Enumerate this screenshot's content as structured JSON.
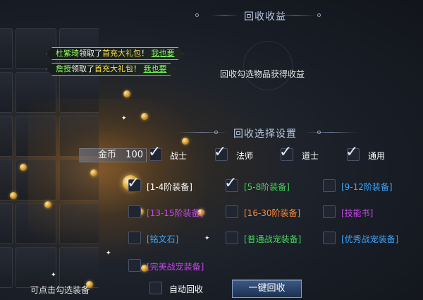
{
  "header": {
    "title": "回收收益",
    "subtitle": "回收勾选物品获得收益"
  },
  "notices": [
    {
      "name": "杜紫琦",
      "action": "领取了",
      "item": "首充大礼包",
      "sep": "！",
      "link": "我也要"
    },
    {
      "name": "詹授",
      "action": "领取了",
      "item": "首充大礼包",
      "sep": "！",
      "link": "我也要"
    }
  ],
  "settings": {
    "title": "回收选择设置"
  },
  "currency": {
    "label": "金币",
    "value": "100"
  },
  "classes": [
    {
      "label": "战士",
      "checked": true
    },
    {
      "label": "法师",
      "checked": true
    },
    {
      "label": "道士",
      "checked": true
    },
    {
      "label": "通用",
      "checked": true
    }
  ],
  "categories": [
    {
      "label": "[1-4阶装备]",
      "color": "#ffffff",
      "checked": true
    },
    {
      "label": "[5-8阶装备]",
      "color": "#45d25c",
      "checked": true
    },
    {
      "label": "[9-12阶装备]",
      "color": "#3aa6ff",
      "checked": false
    },
    {
      "label": "[13-15阶装备]",
      "color": "#c645e6",
      "checked": false
    },
    {
      "label": "[16-30阶装备]",
      "color": "#ff8a3a",
      "checked": false
    },
    {
      "label": "[技能书]",
      "color": "#c645e6",
      "checked": false
    },
    {
      "label": "[铭文石]",
      "color": "#3aa6ff",
      "checked": false
    },
    {
      "label": "[普通战宠装备]",
      "color": "#45d25c",
      "checked": false
    },
    {
      "label": "[优秀战宠装备]",
      "color": "#3aa6ff",
      "checked": false
    },
    {
      "label": "[完美战宠装备]",
      "color": "#c645e6",
      "checked": false
    }
  ],
  "footer": {
    "hint": "可点击勾选装备",
    "auto_label": "自动回收",
    "auto_checked": false,
    "button_label": "一键回收"
  }
}
